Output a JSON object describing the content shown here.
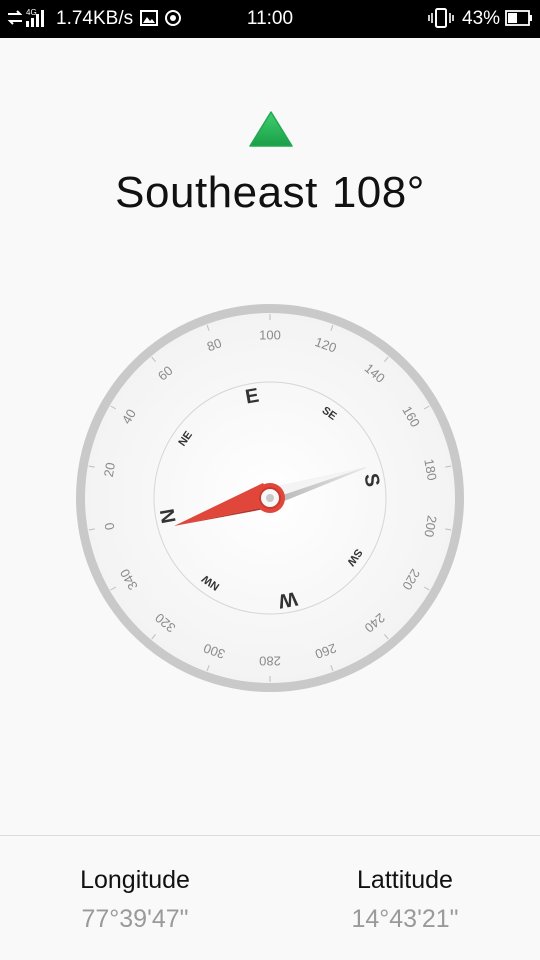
{
  "status_bar": {
    "network_type": "4G",
    "speed": "1.74KB/s",
    "time": "11:00",
    "battery": "43%",
    "icons": [
      "data-transfer-icon",
      "signal-icon",
      "image-icon",
      "location-icon",
      "vibrate-icon",
      "battery-icon"
    ]
  },
  "compass": {
    "direction_name": "Southeast",
    "degrees": "108°",
    "heading_value": 108,
    "accent_color": "#2eb85c",
    "needle_color": "#e0473a",
    "cardinals": [
      "N",
      "E",
      "S",
      "W"
    ],
    "intercardinals": [
      "NE",
      "SE",
      "SW",
      "NW"
    ],
    "degree_labels": [
      "0",
      "20",
      "40",
      "60",
      "80",
      "100",
      "120",
      "140",
      "160",
      "180",
      "200",
      "220",
      "240",
      "260",
      "280",
      "300",
      "320",
      "340"
    ]
  },
  "location": {
    "longitude_label": "Longitude",
    "longitude_value": "77°39'47\"",
    "latitude_label": "Lattitude",
    "latitude_value": "14°43'21\""
  }
}
